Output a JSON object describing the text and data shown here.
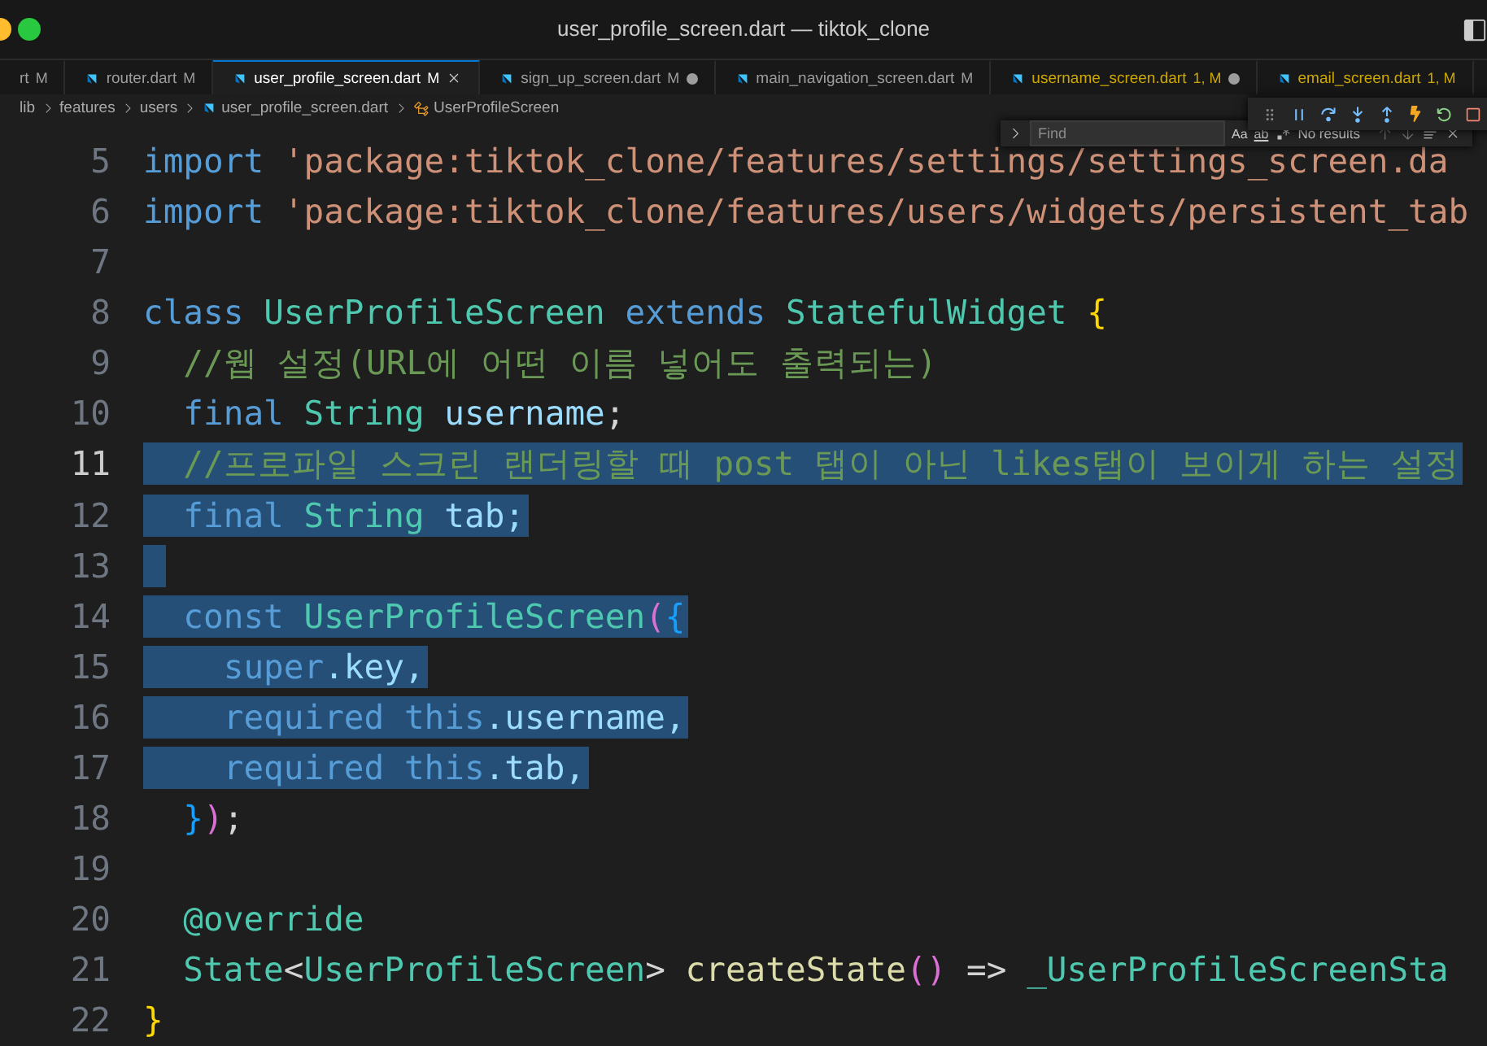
{
  "window": {
    "title": "user_profile_screen.dart — tiktok_clone"
  },
  "tabs": [
    {
      "label": "rt",
      "status": "M",
      "warning": false,
      "selected": false,
      "dirty": false
    },
    {
      "label": "router.dart",
      "status": "M",
      "warning": false,
      "selected": false,
      "dirty": false
    },
    {
      "label": "user_profile_screen.dart",
      "status": "M",
      "warning": false,
      "selected": true,
      "dirty": false
    },
    {
      "label": "sign_up_screen.dart",
      "status": "M",
      "warning": false,
      "selected": false,
      "dirty": true
    },
    {
      "label": "main_navigation_screen.dart",
      "status": "M",
      "warning": false,
      "selected": false,
      "dirty": false
    },
    {
      "label": "username_screen.dart",
      "status": "1, M",
      "warning": true,
      "selected": false,
      "dirty": true
    },
    {
      "label": "email_screen.dart",
      "status": "1, M",
      "warning": true,
      "selected": false,
      "dirty": false
    }
  ],
  "breadcrumb": [
    {
      "label": "lib",
      "kind": "folder"
    },
    {
      "label": "features",
      "kind": "folder"
    },
    {
      "label": "users",
      "kind": "folder"
    },
    {
      "label": "user_profile_screen.dart",
      "kind": "file"
    },
    {
      "label": "UserProfileScreen",
      "kind": "class"
    }
  ],
  "find": {
    "placeholder": "Find",
    "match_case": "Aa",
    "whole_word": "ab",
    "result": "No results"
  },
  "code": [
    {
      "number": "5",
      "selected": false,
      "current": false,
      "tokens": [
        {
          "text": "import ",
          "kind": "keyword"
        },
        {
          "text": "'package:tiktok_clone/features/settings/settings_screen.da",
          "kind": "string"
        }
      ]
    },
    {
      "number": "6",
      "selected": false,
      "current": false,
      "tokens": [
        {
          "text": "import ",
          "kind": "keyword"
        },
        {
          "text": "'package:tiktok_clone/features/users/widgets/persistent_tab",
          "kind": "string"
        }
      ]
    },
    {
      "number": "7",
      "selected": false,
      "current": false
    },
    {
      "number": "8",
      "selected": false,
      "current": false,
      "tokens": [
        {
          "text": "class ",
          "kind": "keyword"
        },
        {
          "text": "UserProfileScreen ",
          "kind": "type"
        },
        {
          "text": "extends ",
          "kind": "keyword"
        },
        {
          "text": "StatefulWidget ",
          "kind": "type"
        },
        {
          "text": "{",
          "kind": "brace1"
        }
      ]
    },
    {
      "number": "9",
      "selected": false,
      "current": false,
      "tokens": [
        {
          "text": "  //웹 설정(URL에 어떤 이름 넣어도 출력되는)",
          "kind": "comment"
        }
      ]
    },
    {
      "number": "10",
      "selected": false,
      "current": false,
      "tokens": [
        {
          "text": "  final ",
          "kind": "keyword"
        },
        {
          "text": "String ",
          "kind": "type"
        },
        {
          "text": "username",
          "kind": "variable"
        },
        {
          "text": ";",
          "kind": "plain"
        }
      ]
    },
    {
      "number": "11",
      "selected": true,
      "current": true,
      "tokens": [
        {
          "text": "  //프로파일 스크린 랜더링할 때 post 탭이 아닌 likes탭이 보이게 하는 설정",
          "kind": "comment"
        }
      ]
    },
    {
      "number": "12",
      "selected": true,
      "current": false,
      "tokens": [
        {
          "text": "  final ",
          "kind": "keyword"
        },
        {
          "text": "String ",
          "kind": "type"
        },
        {
          "text": "tab;",
          "kind": "variable"
        }
      ]
    },
    {
      "number": "13",
      "selected": true,
      "current": false
    },
    {
      "number": "14",
      "selected": true,
      "current": false,
      "tokens": [
        {
          "text": "  const ",
          "kind": "keyword"
        },
        {
          "text": "UserProfileScreen",
          "kind": "type"
        },
        {
          "text": "(",
          "kind": "brace2"
        },
        {
          "text": "{",
          "kind": "brace3"
        }
      ]
    },
    {
      "number": "15",
      "selected": true,
      "current": false,
      "tokens": [
        {
          "text": "    super",
          "kind": "keyword"
        },
        {
          "text": ".key,",
          "kind": "variable"
        }
      ]
    },
    {
      "number": "16",
      "selected": true,
      "current": false,
      "tokens": [
        {
          "text": "    required this",
          "kind": "keyword"
        },
        {
          "text": ".username,",
          "kind": "variable"
        }
      ]
    },
    {
      "number": "17",
      "selected": true,
      "current": false,
      "tokens": [
        {
          "text": "    required this",
          "kind": "keyword"
        },
        {
          "text": ".tab,",
          "kind": "variable"
        }
      ]
    },
    {
      "number": "18",
      "selected": false,
      "current": false,
      "tokens": [
        {
          "text": "  }",
          "kind": "brace3"
        },
        {
          "text": ")",
          "kind": "brace2"
        },
        {
          "text": ";",
          "kind": "plain"
        }
      ]
    },
    {
      "number": "19",
      "selected": false,
      "current": false
    },
    {
      "number": "20",
      "selected": false,
      "current": false,
      "tokens": [
        {
          "text": "  @override",
          "kind": "type"
        }
      ]
    },
    {
      "number": "21",
      "selected": false,
      "current": false,
      "tokens": [
        {
          "text": "  State",
          "kind": "type"
        },
        {
          "text": "<",
          "kind": "plain"
        },
        {
          "text": "UserProfileScreen",
          "kind": "type"
        },
        {
          "text": "> ",
          "kind": "plain"
        },
        {
          "text": "createState",
          "kind": "function"
        },
        {
          "text": "()",
          "kind": "brace2"
        },
        {
          "text": " => ",
          "kind": "plain"
        },
        {
          "text": "_UserProfileScreenSta",
          "kind": "type"
        }
      ]
    },
    {
      "number": "22",
      "selected": false,
      "current": false,
      "tokens": [
        {
          "text": "}",
          "kind": "brace1"
        }
      ]
    }
  ]
}
